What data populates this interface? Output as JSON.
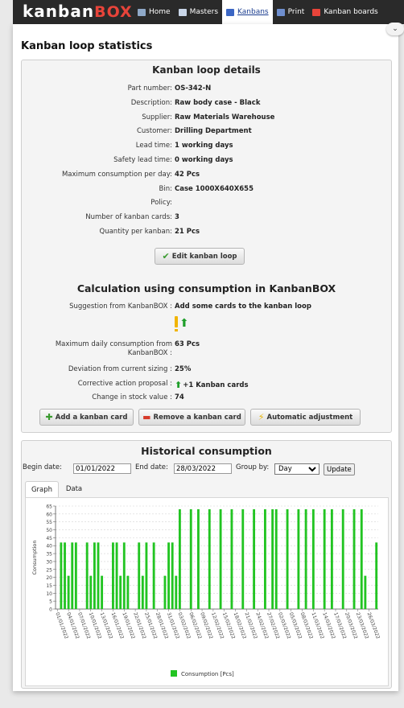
{
  "nav": {
    "logo_main": "kanban",
    "logo_accent": "BOX",
    "items": [
      {
        "label": "Home",
        "icon": "home-icon",
        "color": "#8fa9c8"
      },
      {
        "label": "Masters",
        "icon": "masters-icon",
        "color": "#c9d6e8"
      },
      {
        "label": "Kanbans",
        "icon": "kanbans-icon",
        "color": "#3b66c4"
      },
      {
        "label": "Print",
        "icon": "print-icon",
        "color": "#6f8fcf"
      },
      {
        "label": "Kanban boards",
        "icon": "kanban-boards-icon",
        "color": "#e8443a"
      }
    ],
    "active_index": 2
  },
  "page": {
    "title": "Kanban loop statistics",
    "collapse_glyph": "⌄"
  },
  "details": {
    "title": "Kanban loop details",
    "rows": [
      {
        "label": "Part number:",
        "value": "OS-342-N"
      },
      {
        "label": "Description:",
        "value": "Raw body case - Black"
      },
      {
        "label": "Supplier:",
        "value": "Raw Materials Warehouse"
      },
      {
        "label": "Customer:",
        "value": "Drilling Department"
      },
      {
        "label": "Lead time:",
        "value": "1 working days"
      },
      {
        "label": "Safety lead time:",
        "value": "0 working days"
      },
      {
        "label": "Maximum consumption per day:",
        "value": "42 Pcs"
      },
      {
        "label": "Bin:",
        "value": "Case 1000X640X655"
      },
      {
        "label": "Policy:",
        "value": ""
      },
      {
        "label": "Number of kanban cards:",
        "value": "3"
      },
      {
        "label": "Quantity per kanban:",
        "value": "21 Pcs"
      }
    ],
    "edit_button": "Edit kanban loop"
  },
  "calculation": {
    "title": "Calculation using consumption in KanbanBOX",
    "suggestion_label": "Suggestion from KanbanBOX :",
    "suggestion_value": "Add some cards to the kanban loop",
    "max_daily_label_1": "Maximum daily consumption from",
    "max_daily_label_2": "KanbanBOX :",
    "max_daily_value": "63 Pcs",
    "deviation_label": "Deviation from current sizing :",
    "deviation_value": "25%",
    "corrective_label": "Corrective action proposal :",
    "corrective_value": "+1 Kanban cards",
    "stock_label": "Change in stock value :",
    "stock_value": "74",
    "buttons": {
      "add": "Add a kanban card",
      "remove": "Remove a kanban card",
      "auto": "Automatic adjustment"
    }
  },
  "historical": {
    "title": "Historical consumption",
    "begin_label": "Begin date:",
    "begin_value": "01/01/2022",
    "end_label": "End date:",
    "end_value": "28/03/2022",
    "group_label": "Group by:",
    "group_value": "Day",
    "update_label": "Update",
    "tabs": [
      "Graph",
      "Data"
    ],
    "active_tab": 0
  },
  "chart_data": {
    "type": "bar",
    "title": "",
    "xlabel": "",
    "ylabel": "Consumption",
    "ylim": [
      0,
      65
    ],
    "yticks": [
      0,
      5,
      10,
      15,
      20,
      25,
      30,
      35,
      40,
      45,
      50,
      55,
      60,
      65
    ],
    "grid": true,
    "legend_position": "bottom",
    "color": "#22c422",
    "x_labels": [
      "01/01/2022",
      "04/01/2022",
      "07/01/2022",
      "10/01/2022",
      "13/01/2022",
      "16/01/2022",
      "19/01/2022",
      "22/01/2022",
      "25/01/2022",
      "28/01/2022",
      "31/01/2022",
      "03/02/2022",
      "06/02/2022",
      "09/02/2022",
      "12/02/2022",
      "15/02/2022",
      "18/02/2022",
      "21/02/2022",
      "24/02/2022",
      "27/02/2022",
      "02/03/2022",
      "05/03/2022",
      "08/03/2022",
      "11/03/2022",
      "14/03/2022",
      "17/03/2022",
      "20/03/2022",
      "23/03/2022",
      "26/03/2022"
    ],
    "series": [
      {
        "name": "Consumption [Pcs]",
        "values": [
          0,
          42,
          42,
          21,
          42,
          42,
          0,
          0,
          42,
          21,
          42,
          42,
          21,
          0,
          0,
          42,
          42,
          21,
          42,
          21,
          0,
          0,
          42,
          21,
          42,
          0,
          42,
          0,
          0,
          21,
          42,
          42,
          21,
          63,
          0,
          0,
          63,
          0,
          63,
          0,
          0,
          63,
          0,
          0,
          63,
          0,
          0,
          63,
          0,
          0,
          63,
          0,
          0,
          63,
          0,
          0,
          63,
          0,
          63,
          63,
          0,
          0,
          63,
          0,
          0,
          63,
          0,
          63,
          0,
          63,
          0,
          0,
          63,
          0,
          63,
          0,
          0,
          63,
          0,
          0,
          63,
          0,
          63,
          21,
          0,
          0,
          42
        ]
      }
    ]
  }
}
